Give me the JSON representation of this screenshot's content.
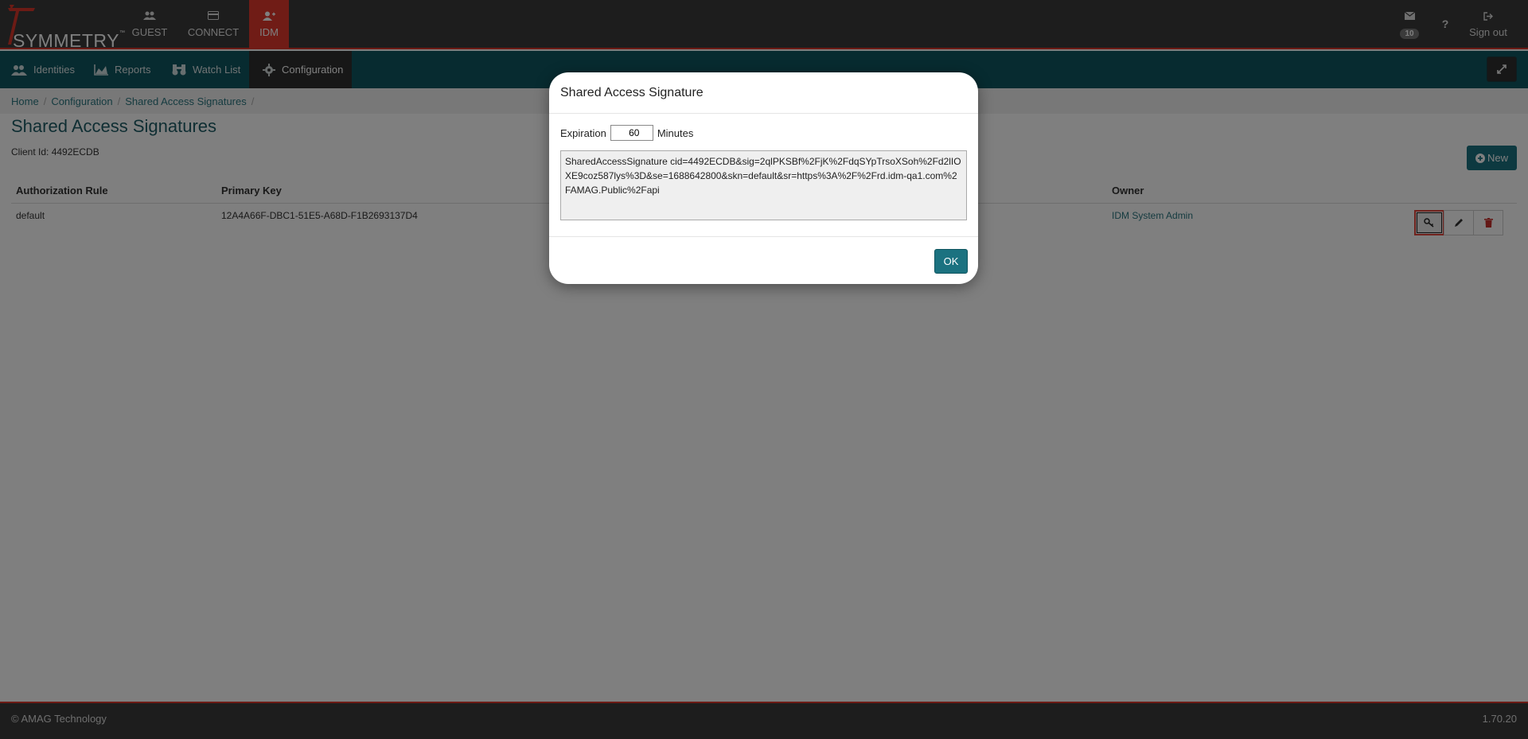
{
  "header": {
    "logo_text": "SYMMETRY",
    "logo_tm": "™",
    "modules": [
      {
        "label": "GUEST",
        "icon": "users-icon"
      },
      {
        "label": "CONNECT",
        "icon": "card-icon"
      },
      {
        "label": "IDM",
        "icon": "user-plus-icon",
        "active": true
      }
    ],
    "messages_count": "10",
    "help_label": "?",
    "signout_label": "Sign out"
  },
  "nav": {
    "items": [
      {
        "label": "Identities",
        "icon": "users-icon"
      },
      {
        "label": "Reports",
        "icon": "area-chart-icon"
      },
      {
        "label": "Watch List",
        "icon": "binoculars-icon"
      },
      {
        "label": "Configuration",
        "icon": "gear-icon",
        "active": true
      }
    ]
  },
  "breadcrumb": [
    "Home",
    "Configuration",
    "Shared Access Signatures"
  ],
  "page": {
    "title": "Shared Access Signatures",
    "client_id": "Client Id: 4492ECDB",
    "new_label": "New"
  },
  "table": {
    "headers": [
      "Authorization Rule",
      "Primary Key",
      "Owner"
    ],
    "rows": [
      {
        "rule": "default",
        "key": "12A4A66F-DBC1-51E5-A68D-F1B2693137D4",
        "owner": "IDM System Admin"
      }
    ]
  },
  "modal": {
    "title": "Shared Access Signature",
    "expiration_label": "Expiration",
    "expiration_value": "60",
    "minutes_label": "Minutes",
    "signature": "SharedAccessSignature cid=4492ECDB&sig=2qlPKSBf%2FjK%2FdqSYpTrsoXSoh%2Fd2lIOXE9coz587lys%3D&se=1688642800&skn=default&sr=https%3A%2F%2Frd.idm-qa1.com%2FAMAG.Public%2Fapi",
    "ok_label": "OK"
  },
  "footer": {
    "copyright": "© AMAG Technology",
    "version": "1.70.20"
  },
  "colors": {
    "accent_red": "#e0392c",
    "nav_teal": "#0e5660",
    "button_teal": "#1b7280",
    "header_dark": "#3a3a3a"
  }
}
